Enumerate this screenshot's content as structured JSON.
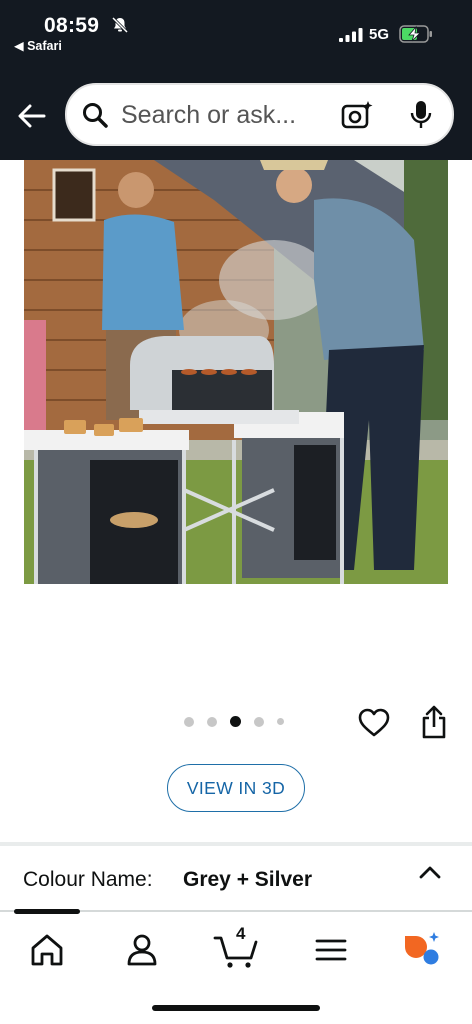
{
  "status_bar": {
    "time": "08:59",
    "back_app": "◀ Safari",
    "network": "5G"
  },
  "search": {
    "placeholder": "Search or ask..."
  },
  "icons": {
    "back": "back-arrow-icon",
    "search": "search-icon",
    "camera": "camera-lens-icon",
    "mic": "microphone-icon",
    "heart": "heart-icon",
    "share": "share-icon",
    "home": "home-icon",
    "profile": "profile-icon",
    "cart": "cart-icon",
    "menu": "menu-icon",
    "rufus": "rufus-assistant-icon"
  },
  "gallery": {
    "dot_count": 5,
    "active_index": 2
  },
  "view_3d_label": "VIEW IN 3D",
  "variant": {
    "label": "Colour Name:",
    "value": "Grey + Silver"
  },
  "nav": {
    "cart_count": "4"
  },
  "colors": {
    "header_bg": "#131921",
    "link_blue": "#1565a6",
    "rufus_orange": "#f26722",
    "rufus_blue": "#2f7de1"
  }
}
